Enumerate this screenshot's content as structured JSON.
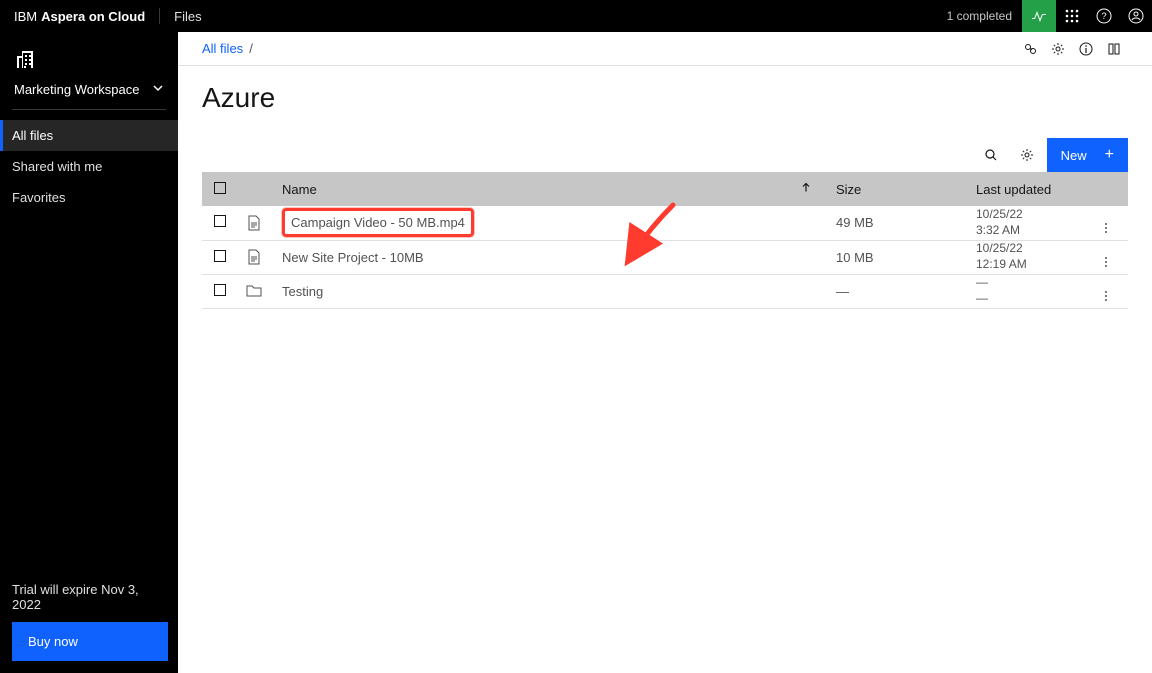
{
  "header": {
    "brand_prefix": "IBM",
    "brand_product": "Aspera on Cloud",
    "files_link": "Files",
    "status": "1 completed"
  },
  "sidebar": {
    "workspace_name": "Marketing Workspace",
    "items": [
      {
        "label": "All files",
        "active": true
      },
      {
        "label": "Shared with me",
        "active": false
      },
      {
        "label": "Favorites",
        "active": false
      }
    ],
    "trial_text": "Trial will expire Nov 3, 2022",
    "buy_label": "Buy now"
  },
  "breadcrumb": {
    "root": "All files",
    "sep": "/"
  },
  "page": {
    "title": "Azure"
  },
  "toolbar": {
    "new_label": "New"
  },
  "table": {
    "headers": {
      "name": "Name",
      "size": "Size",
      "updated": "Last updated"
    },
    "rows": [
      {
        "name": "Campaign Video - 50 MB.mp4",
        "size": "49 MB",
        "date": "10/25/22",
        "time": "3:32 AM",
        "type": "file",
        "highlight": true
      },
      {
        "name": "New Site Project - 10MB",
        "size": "10 MB",
        "date": "10/25/22",
        "time": "12:19 AM",
        "type": "file",
        "highlight": false
      },
      {
        "name": "Testing",
        "size": "—",
        "date": "—",
        "time": "—",
        "type": "folder",
        "highlight": false
      }
    ]
  }
}
